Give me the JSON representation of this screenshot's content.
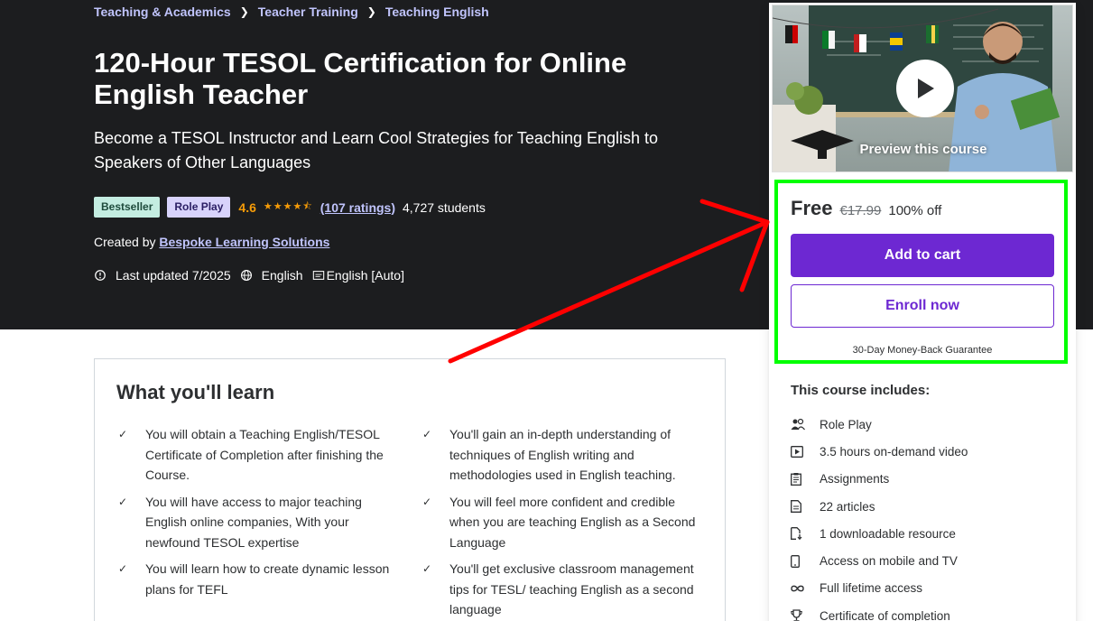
{
  "breadcrumb": [
    "Teaching & Academics",
    "Teacher Training",
    "Teaching English"
  ],
  "course": {
    "title": "120-Hour TESOL Certification for Online English Teacher",
    "subtitle": "Become a TESOL Instructor and Learn Cool Strategies for Teaching English to Speakers of Other Languages",
    "badges": [
      "Bestseller",
      "Role Play"
    ],
    "rating": "4.6",
    "rating_value": 4.6,
    "stars": "★★★★⯪",
    "ratings_count": "(107 ratings)",
    "students": "4,727 students",
    "created_by_label": "Created by",
    "author": "Bespoke Learning Solutions",
    "last_updated": "Last updated 7/2025",
    "language": "English",
    "captions": "English [Auto]"
  },
  "learn": {
    "heading": "What you'll learn",
    "col1": [
      "You will obtain a Teaching English/TESOL Certificate of Completion after finishing the Course.",
      "You will have access to major teaching English online companies, With your newfound TESOL expertise",
      "You will learn how to create dynamic lesson plans for TEFL"
    ],
    "col2": [
      "You'll gain an in-depth understanding of techniques of English writing and methodologies used in English teaching.",
      "You will feel more confident and credible when you are teaching English as a Second Language",
      "You'll get exclusive classroom management tips for TESL/ teaching English as a second language"
    ]
  },
  "sidebar": {
    "preview_label": "Preview this course",
    "price": "Free",
    "original_price": "€17.99",
    "discount": "100% off",
    "add_to_cart": "Add to cart",
    "enroll_now": "Enroll now",
    "guarantee": "30-Day Money-Back Guarantee",
    "includes_title": "This course includes:",
    "includes": [
      {
        "icon": "role-play-icon",
        "label": "Role Play"
      },
      {
        "icon": "video-icon",
        "label": "3.5 hours on-demand video"
      },
      {
        "icon": "assignment-icon",
        "label": "Assignments"
      },
      {
        "icon": "article-icon",
        "label": "22 articles"
      },
      {
        "icon": "download-icon",
        "label": "1 downloadable resource"
      },
      {
        "icon": "mobile-icon",
        "label": "Access on mobile and TV"
      },
      {
        "icon": "infinity-icon",
        "label": "Full lifetime access"
      },
      {
        "icon": "trophy-icon",
        "label": "Certificate of completion"
      }
    ]
  },
  "colors": {
    "hero_bg": "#1c1d1f",
    "accent_purple": "#6d28d2",
    "link_lavender": "#c0c4fc",
    "star_orange": "#f69c08",
    "highlight_green": "#00ff00",
    "annotation_red": "#ff0000"
  }
}
